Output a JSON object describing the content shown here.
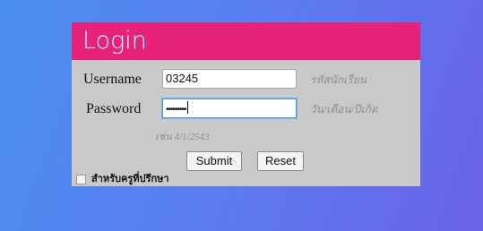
{
  "login": {
    "title": "Login",
    "username": {
      "label": "Username",
      "value": "03245",
      "hint": "รหัสนักเรียน"
    },
    "password": {
      "label": "Password",
      "masked_value": "•••••••••",
      "hint": "วัน/เดือน/ปีเกิด",
      "example": "เช่น 4/1/2543"
    },
    "submit_label": "Submit",
    "reset_label": "Reset",
    "advisor_checkbox_label": "สำหรับครูที่ปรึกษา"
  },
  "colors": {
    "header": "#e6227a",
    "panel": "#c9c9c9"
  }
}
